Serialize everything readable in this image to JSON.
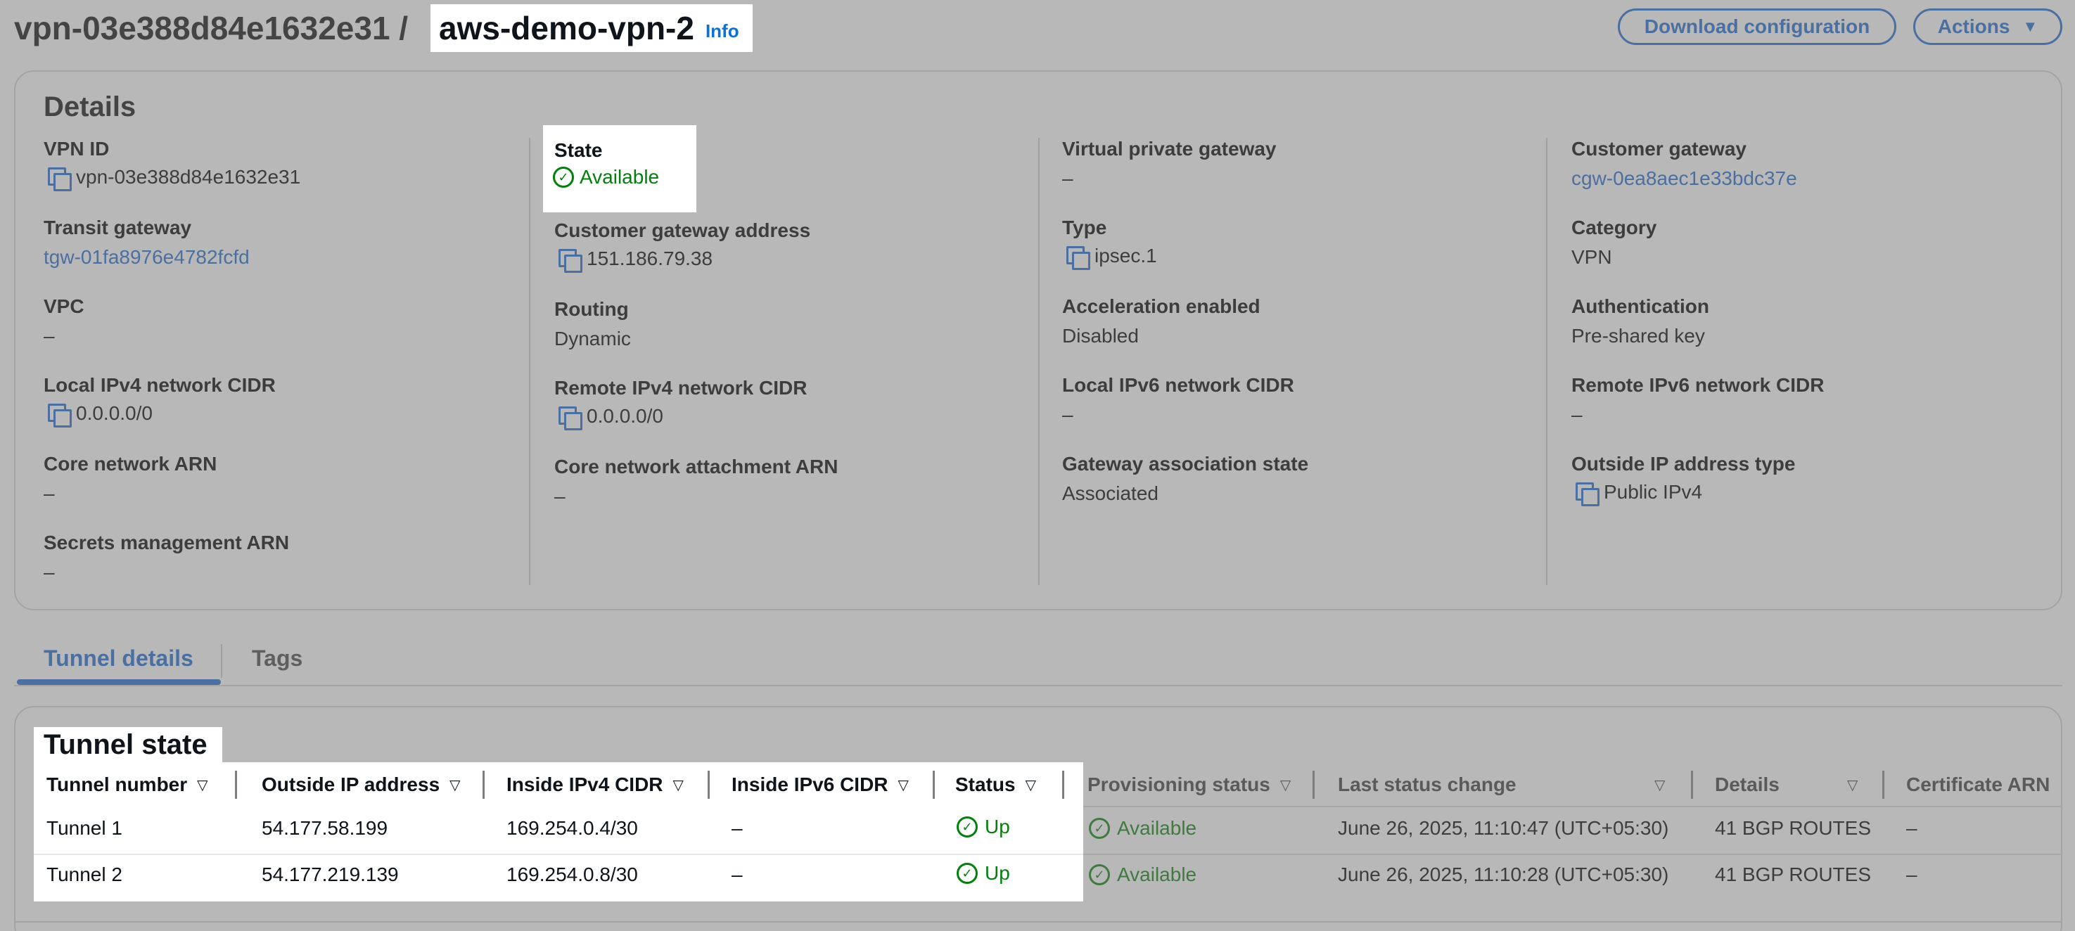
{
  "header": {
    "vpn_prefix": "vpn-03e388d84e1632e31 /",
    "vpn_name": "aws-demo-vpn-2",
    "info_link": "Info",
    "download_button": "Download configuration",
    "actions_button": "Actions"
  },
  "details": {
    "title": "Details",
    "vpn_id": {
      "label": "VPN ID",
      "value": "vpn-03e388d84e1632e31"
    },
    "transit_gateway": {
      "label": "Transit gateway",
      "value": "tgw-01fa8976e4782fcfd"
    },
    "vpc": {
      "label": "VPC",
      "value": "–"
    },
    "local_ipv4_cidr": {
      "label": "Local IPv4 network CIDR",
      "value": "0.0.0.0/0"
    },
    "core_network_arn": {
      "label": "Core network ARN",
      "value": "–"
    },
    "secrets_arn": {
      "label": "Secrets management ARN",
      "value": "–"
    },
    "state": {
      "label": "State",
      "value": "Available"
    },
    "customer_gateway_address": {
      "label": "Customer gateway address",
      "value": "151.186.79.38"
    },
    "routing": {
      "label": "Routing",
      "value": "Dynamic"
    },
    "remote_ipv4_cidr": {
      "label": "Remote IPv4 network CIDR",
      "value": "0.0.0.0/0"
    },
    "core_network_attachment_arn": {
      "label": "Core network attachment ARN",
      "value": "–"
    },
    "virtual_private_gateway": {
      "label": "Virtual private gateway",
      "value": "–"
    },
    "type": {
      "label": "Type",
      "value": "ipsec.1"
    },
    "acceleration": {
      "label": "Acceleration enabled",
      "value": "Disabled"
    },
    "local_ipv6_cidr": {
      "label": "Local IPv6 network CIDR",
      "value": "–"
    },
    "gateway_association": {
      "label": "Gateway association state",
      "value": "Associated"
    },
    "customer_gateway": {
      "label": "Customer gateway",
      "value": "cgw-0ea8aec1e33bdc37e"
    },
    "category": {
      "label": "Category",
      "value": "VPN"
    },
    "authentication": {
      "label": "Authentication",
      "value": "Pre-shared key"
    },
    "remote_ipv6_cidr": {
      "label": "Remote IPv6 network CIDR",
      "value": "–"
    },
    "outside_ip_type": {
      "label": "Outside IP address type",
      "value": "Public IPv4"
    }
  },
  "tabs": [
    "Tunnel details",
    "Tags"
  ],
  "tunnel": {
    "title": "Tunnel state",
    "columns": [
      "Tunnel number",
      "Outside IP address",
      "Inside IPv4 CIDR",
      "Inside IPv6 CIDR",
      "Status",
      "Provisioning status",
      "Last status change",
      "Details",
      "Certificate ARN"
    ],
    "rows": [
      {
        "number": "Tunnel 1",
        "outside_ip": "54.177.58.199",
        "inside_ipv4": "169.254.0.4/30",
        "inside_ipv6": "–",
        "status": "Up",
        "provisioning": "Available",
        "last_change": "June 26, 2025, 11:10:47 (UTC+05:30)",
        "details": "41 BGP ROUTES",
        "cert_arn": "–"
      },
      {
        "number": "Tunnel 2",
        "outside_ip": "54.177.219.139",
        "inside_ipv4": "169.254.0.8/30",
        "inside_ipv6": "–",
        "status": "Up",
        "provisioning": "Available",
        "last_change": "June 26, 2025, 11:10:28 (UTC+05:30)",
        "details": "41 BGP ROUTES",
        "cert_arn": "–"
      }
    ]
  },
  "colors": {
    "overlay_gray": "#b8b8b8",
    "link_blue": "#4a6fa0",
    "success_green": "#037f0c"
  }
}
